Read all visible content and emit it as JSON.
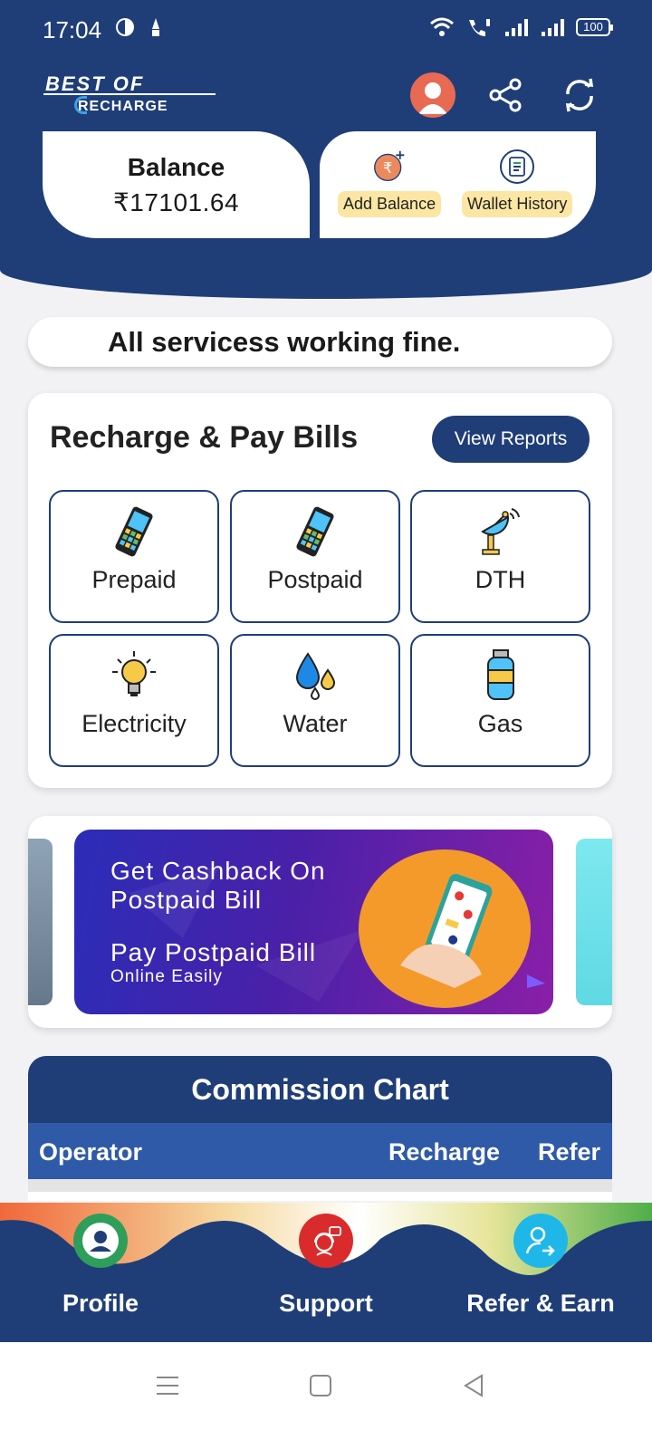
{
  "status_bar": {
    "time": "17:04",
    "battery": "100"
  },
  "header": {
    "logo_top": "BEST OF",
    "logo_bottom": "RECHARGE",
    "icons": [
      "avatar",
      "share-icon",
      "refresh-icon"
    ]
  },
  "balance": {
    "label": "Balance",
    "value": "₹17101.64"
  },
  "wallet_actions": [
    {
      "label": "Add Balance",
      "icon": "add-rupee-icon"
    },
    {
      "label": "Wallet History",
      "icon": "history-icon"
    }
  ],
  "notice": {
    "text": "All servicess working fine."
  },
  "services": {
    "title": "Recharge & Pay Bills",
    "view_reports_label": "View Reports",
    "items": [
      {
        "label": "Prepaid",
        "icon": "mobile-phone-icon"
      },
      {
        "label": "Postpaid",
        "icon": "mobile-phone-icon"
      },
      {
        "label": "DTH",
        "icon": "satellite-dish-icon"
      },
      {
        "label": "Electricity",
        "icon": "light-bulb-icon"
      },
      {
        "label": "Water",
        "icon": "water-drops-icon"
      },
      {
        "label": "Gas",
        "icon": "gas-cylinder-icon"
      }
    ]
  },
  "banner": {
    "line1": "Get Cashback On",
    "line2": "Postpaid Bill",
    "line3": "Pay Postpaid Bill",
    "line4": "Online Easily"
  },
  "commission_chart": {
    "title": "Commission Chart",
    "columns": [
      "Operator",
      "Recharge",
      "Refer"
    ]
  },
  "bottom_nav": [
    {
      "label": "Profile",
      "icon": "profile-icon",
      "color": "#2e9e5b"
    },
    {
      "label": "Support",
      "icon": "support-icon",
      "color": "#d92b2b"
    },
    {
      "label": "Refer & Earn",
      "icon": "refer-user-icon",
      "color": "#1fb7e8"
    }
  ],
  "colors": {
    "primary": "#1f3e78",
    "table_header": "#2e5aa8",
    "label_highlight": "#fbe7a3"
  }
}
